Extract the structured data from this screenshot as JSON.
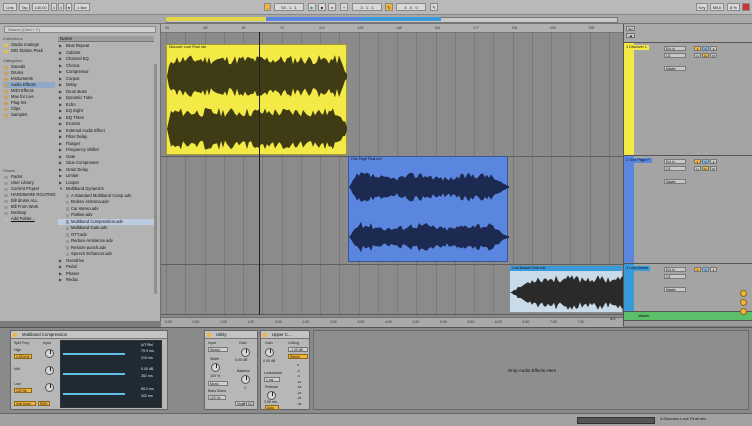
{
  "transport": {
    "link": "Link",
    "tap": "Tap",
    "tempo": "130.00",
    "sig_num": "4",
    "sig_den": "4",
    "metro": "1 Bar",
    "position": "53 . 1 . 1",
    "loop_start": "3 . 1 . 1",
    "loop_len": "4 . 0 . 0",
    "key": "Key",
    "midi": "MIDI",
    "cpu": "8 %"
  },
  "browser": {
    "search_placeholder": "Search (Cmd + F)",
    "collections_title": "Collections",
    "collections": [
      "Studio routings",
      "DID Station Pack"
    ],
    "categories_title": "Categories",
    "categories": [
      "Sounds",
      "Drums",
      "Instruments",
      "Audio Effects",
      "MIDI Effects",
      "Max for Live",
      "Plug-Ins",
      "Clips",
      "Samples"
    ],
    "places_title": "Places",
    "places": [
      "Packs",
      "User Library",
      "Current Project",
      "HARDWARE ROUTING",
      "Bill drums ALL",
      "Bill From Work",
      "Desktop",
      "Add Folder..."
    ],
    "name_header": "Name",
    "files": [
      {
        "name": "Beat Repeat",
        "kind": "folder"
      },
      {
        "name": "Cabinet",
        "kind": "folder"
      },
      {
        "name": "Channel EQ",
        "kind": "folder"
      },
      {
        "name": "Chorus",
        "kind": "folder"
      },
      {
        "name": "Compressor",
        "kind": "folder"
      },
      {
        "name": "Corpus",
        "kind": "folder"
      },
      {
        "name": "Delay",
        "kind": "folder"
      },
      {
        "name": "Drum Buss",
        "kind": "folder"
      },
      {
        "name": "Dynamic Tube",
        "kind": "folder"
      },
      {
        "name": "Echo",
        "kind": "folder"
      },
      {
        "name": "EQ Eight",
        "kind": "folder"
      },
      {
        "name": "EQ Three",
        "kind": "folder"
      },
      {
        "name": "Erosion",
        "kind": "folder"
      },
      {
        "name": "External Audio Effect",
        "kind": "folder"
      },
      {
        "name": "Filter Delay",
        "kind": "folder"
      },
      {
        "name": "Flanger",
        "kind": "folder"
      },
      {
        "name": "Frequency Shifter",
        "kind": "folder"
      },
      {
        "name": "Gate",
        "kind": "folder"
      },
      {
        "name": "Glue Compressor",
        "kind": "folder"
      },
      {
        "name": "Grain Delay",
        "kind": "folder"
      },
      {
        "name": "Limiter",
        "kind": "folder"
      },
      {
        "name": "Looper",
        "kind": "folder"
      },
      {
        "name": "Multiband Dynamics",
        "kind": "open"
      },
      {
        "name": "A Standard Multiband Comp.adv",
        "kind": "child"
      },
      {
        "name": "Broken Antenna.adv",
        "kind": "child"
      },
      {
        "name": "Car stereo.adv",
        "kind": "child"
      },
      {
        "name": "Flatline.adv",
        "kind": "child"
      },
      {
        "name": "Multiband Compression.adv",
        "kind": "child-selected"
      },
      {
        "name": "Multiband Gate.adv",
        "kind": "child"
      },
      {
        "name": "OTT.adv",
        "kind": "child"
      },
      {
        "name": "Reduce Ambience.adv",
        "kind": "child"
      },
      {
        "name": "Restore punch.adv",
        "kind": "child"
      },
      {
        "name": "Speech Enhancer.adv",
        "kind": "child"
      },
      {
        "name": "Overdrive",
        "kind": "folder"
      },
      {
        "name": "Pedal",
        "kind": "folder"
      },
      {
        "name": "Phaser",
        "kind": "folder"
      },
      {
        "name": "Redux",
        "kind": "folder"
      }
    ]
  },
  "arrangement": {
    "ruler": [
      "49",
      "65",
      "81",
      "97",
      "113",
      "129",
      "145",
      "161",
      "177",
      "193",
      "209",
      "225"
    ],
    "times": [
      "0:00",
      "0:30",
      "1:00",
      "1:30",
      "2:00",
      "2:30",
      "3:00",
      "3:30",
      "4:00",
      "4:30",
      "5:00",
      "5:30",
      "6:00",
      "6:30",
      "7:00",
      "7:30"
    ],
    "page": "4/1",
    "clips": [
      {
        "name": "Discover Love Final mix",
        "color": "#f4ea45"
      },
      {
        "name": "One Page Final mix",
        "color": "#5b86e0"
      },
      {
        "name": "Lost Basket Final mix",
        "color": "#3a9ad9"
      }
    ]
  },
  "tracks": [
    {
      "name": "1 Discover L",
      "color": "#f4ea45",
      "input": "Ext. In",
      "mon": "1/2",
      "master": "Master",
      "num": "1"
    },
    {
      "name": "2 One Page F",
      "color": "#5b86e0",
      "input": "Ext. In",
      "mon": "1/2",
      "master": "Master",
      "num": "2"
    },
    {
      "name": "3 Lost Baske",
      "color": "#3a9ad9",
      "input": "Ext. In",
      "mon": "1/2",
      "master": "Master",
      "num": "3"
    },
    {
      "name": "Master",
      "color": "#5bbf6a",
      "input": "",
      "mon": "",
      "master": "",
      "num": ""
    }
  ],
  "devices": {
    "multiband": {
      "title": "Multiband Compression",
      "split_freq": "Split Freq",
      "input": "Input",
      "high": "High",
      "high_freq": "2.50 kHz",
      "mid": "Mid",
      "low": "Low",
      "low_freq": "120 Hz",
      "soft_knee": "Soft Knee",
      "rms": "RMS",
      "above_below": "A/T/Rel",
      "values": [
        "79.9 ms",
        "319 ms",
        "0.00 dB",
        "352 ms",
        "85.2 ms",
        "302 ms"
      ],
      "output": "Output",
      "amount": "Amount",
      "time": "Time",
      "output2": "Output",
      "amt_val": "100 %",
      "time_val": "100 %",
      "t_label": "T",
      "s_label": "S"
    },
    "utility": {
      "title": "Utility",
      "input": "Input",
      "stereo": "Stereo",
      "gain": "Gain",
      "gain_val": "0.00 dB",
      "width": "Width",
      "width_val": "100 %",
      "mono": "Mono",
      "balance": "Balance",
      "balance_val": "C",
      "bass_mono": "Bass Mono",
      "bass_freq": "120 Hz",
      "mute": "Mute",
      "dc": "DC"
    },
    "upper": {
      "title": "Upper C...",
      "gain": "Gain",
      "ceiling": "Ceiling",
      "ceiling_val": "-1.00 dB",
      "stereo": "Stereo",
      "lookahead": "Lookahead",
      "lookahead_val": "1 ms",
      "release": "Release",
      "release_val": "3.00 ms",
      "auto": "Auto",
      "gain_val": "0.00 dB",
      "scale": [
        "0",
        "-3",
        "-6",
        "-12",
        "-18",
        "-24",
        "-36",
        "-48"
      ]
    },
    "drop_text": "Drop Audio Effects Here"
  },
  "status": {
    "right_text": "4-Discover Love Final mix"
  }
}
